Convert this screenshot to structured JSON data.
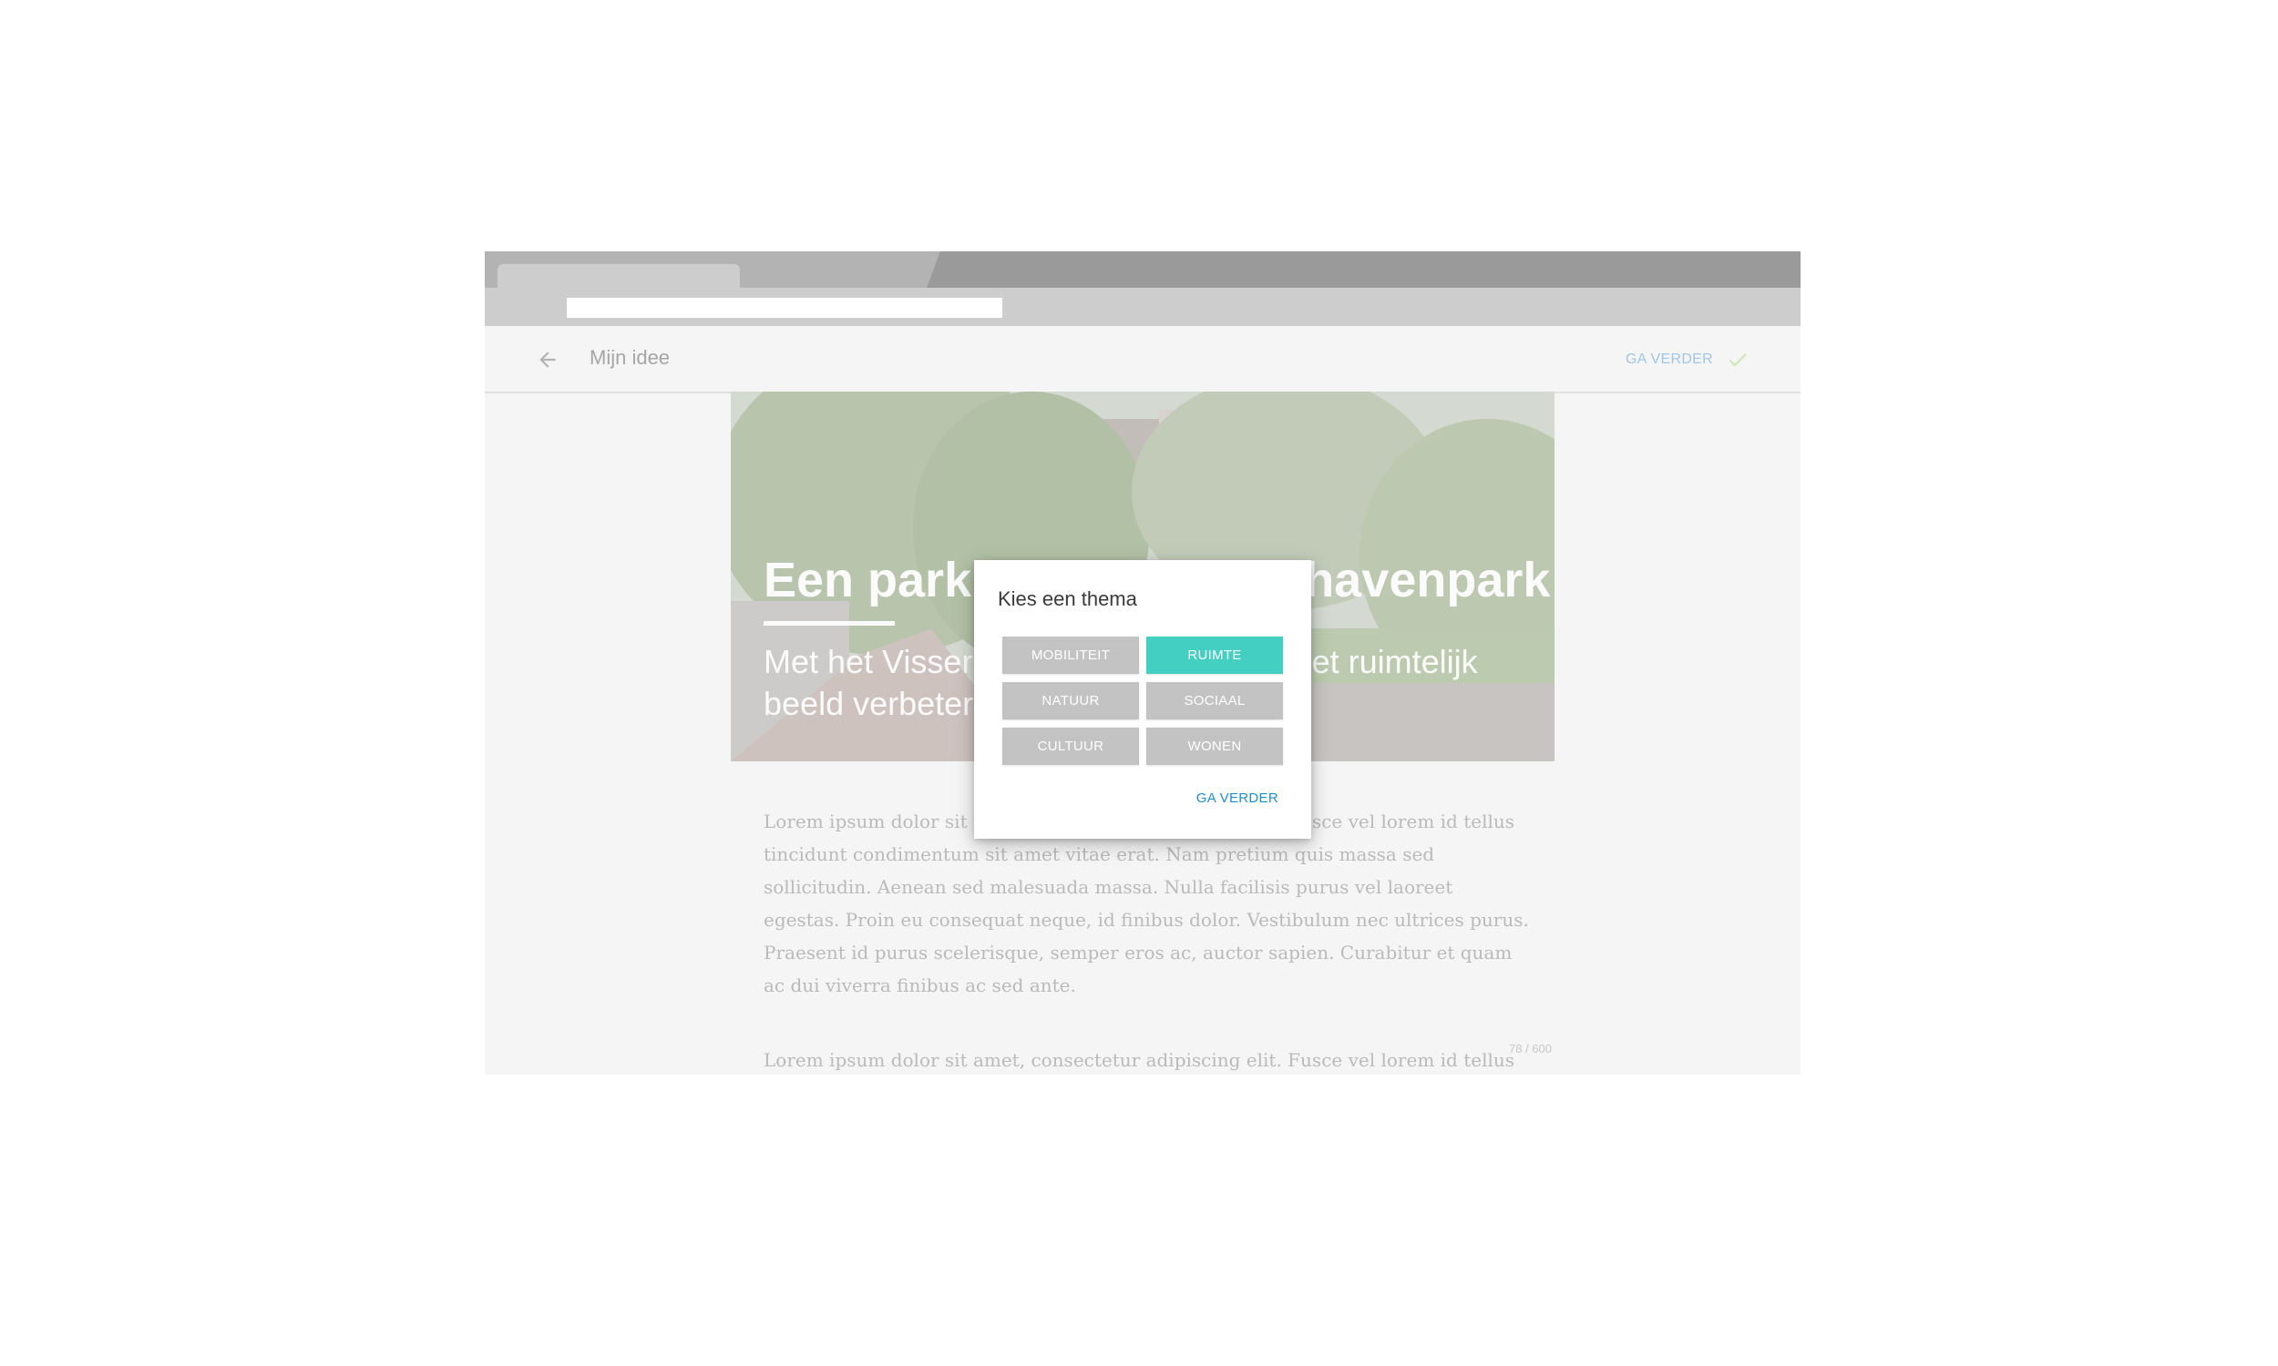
{
  "app_bar": {
    "title": "Mijn idee",
    "continue_label": "GA VERDER",
    "back_icon": "arrow-left-icon",
    "check_icon": "check-icon"
  },
  "hero": {
    "title": "Een park in het Vissershavenpark",
    "subtitle": "Met het Vissershavenpark willen we het ruimtelijk beeld verbeteren"
  },
  "body": {
    "paragraph_1": "Lorem ipsum dolor sit amet, consectetur adipiscing elit. Fusce vel lorem id tellus tincidunt condimentum sit amet vitae erat. Nam pretium quis massa sed sollicitudin. Aenean sed malesuada massa. Nulla facilisis purus vel laoreet egestas. Proin eu consequat neque, id finibus dolor. Vestibulum nec ultrices purus. Praesent id purus scelerisque, semper eros ac, auctor sapien. Curabitur et quam ac dui viverra finibus ac sed ante.",
    "char_counter": "78 / 600",
    "paragraph_2": "Lorem ipsum dolor sit amet, consectetur adipiscing elit. Fusce vel lorem id tellus"
  },
  "dialog": {
    "title": "Kies een thema",
    "themes": [
      {
        "label": "MOBILITEIT",
        "selected": false
      },
      {
        "label": "RUIMTE",
        "selected": true
      },
      {
        "label": "NATUUR",
        "selected": false
      },
      {
        "label": "SOCIAAL",
        "selected": false
      },
      {
        "label": "CULTUUR",
        "selected": false
      },
      {
        "label": "WONEN",
        "selected": false
      }
    ],
    "continue_label": "GA VERDER"
  },
  "colors": {
    "accent_selected": "#44cfc3",
    "link_blue": "#1b8ed8",
    "button_grey": "#c3c3c3"
  }
}
